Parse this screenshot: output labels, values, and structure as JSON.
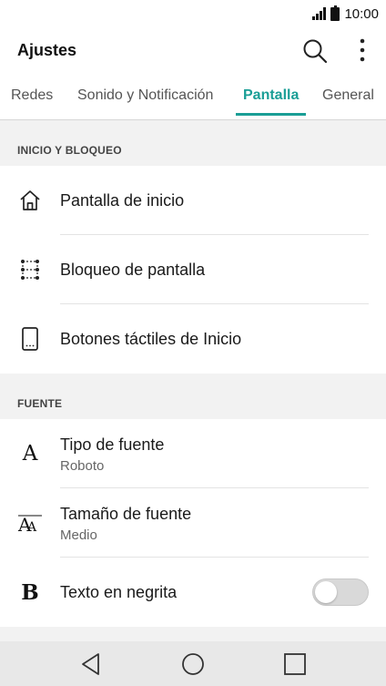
{
  "status_bar": {
    "time": "10:00",
    "icons": [
      "signal-icon",
      "battery-icon"
    ]
  },
  "header": {
    "title": "Ajustes",
    "actions": [
      "search-icon",
      "more-vert-icon"
    ]
  },
  "tabs": [
    {
      "label": "Redes",
      "active": false
    },
    {
      "label": "Sonido y Notificación",
      "active": false
    },
    {
      "label": "Pantalla",
      "active": true
    },
    {
      "label": "General",
      "active": false
    }
  ],
  "sections": [
    {
      "title": "INICIO Y BLOQUEO",
      "items": [
        {
          "label": "Pantalla de inicio",
          "icon": "home-icon"
        },
        {
          "label": "Bloqueo de pantalla",
          "icon": "lock-pattern-icon"
        },
        {
          "label": "Botones táctiles de Inicio",
          "icon": "phone-touch-buttons-icon"
        }
      ]
    },
    {
      "title": "FUENTE",
      "items": [
        {
          "label": "Tipo de fuente",
          "sublabel": "Roboto",
          "icon": "font-type-icon",
          "glyph": "A"
        },
        {
          "label": "Tamaño de fuente",
          "sublabel": "Medio",
          "icon": "font-size-icon",
          "glyph": "AA"
        },
        {
          "label": "Texto en negrita",
          "icon": "bold-text-icon",
          "glyph": "B",
          "toggle": false
        }
      ]
    }
  ],
  "nav_bar": {
    "buttons": [
      "back-icon",
      "home-circle-icon",
      "recents-icon"
    ]
  },
  "colors": {
    "accent": "#1a9e96",
    "background": "#f2f2f2",
    "surface": "#ffffff",
    "nav_bar": "#e8e8e8"
  }
}
